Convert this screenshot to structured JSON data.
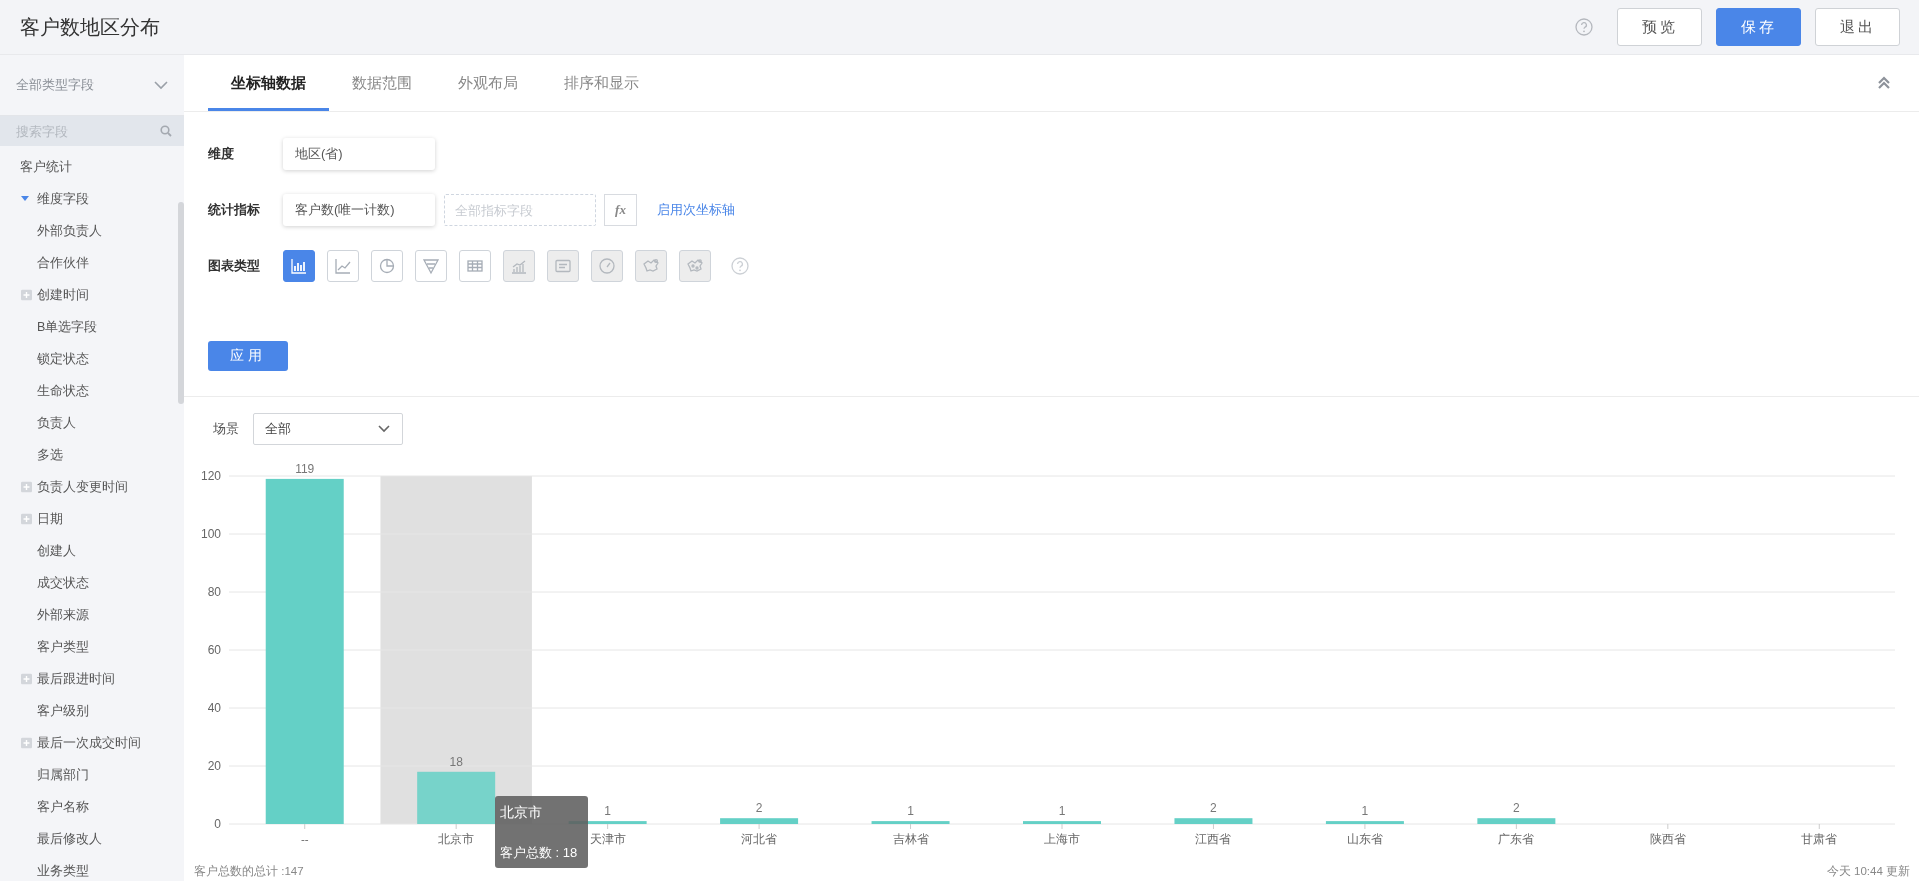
{
  "header": {
    "title": "客户数地区分布",
    "buttons": [
      {
        "label": "预览",
        "kind": "default"
      },
      {
        "label": "保存",
        "kind": "primary"
      },
      {
        "label": "退出",
        "kind": "default"
      }
    ]
  },
  "sidebar": {
    "type_filter": "全部类型字段",
    "search": {
      "placeholder": "搜索字段"
    },
    "tree": [
      {
        "label": "客户统计",
        "children": [
          {
            "label": "维度字段",
            "expanded": true,
            "children": [
              {
                "label": "外部负责人"
              },
              {
                "label": "合作伙伴"
              },
              {
                "label": "创建时间",
                "expanded": false
              },
              {
                "label": "B单选字段"
              },
              {
                "label": "锁定状态"
              },
              {
                "label": "生命状态"
              },
              {
                "label": "负责人"
              },
              {
                "label": "多选"
              },
              {
                "label": "负责人变更时间",
                "expanded": false
              },
              {
                "label": "日期",
                "expanded": false
              },
              {
                "label": "创建人"
              },
              {
                "label": "成交状态"
              },
              {
                "label": "外部来源"
              },
              {
                "label": "客户类型"
              },
              {
                "label": "最后跟进时间",
                "expanded": false
              },
              {
                "label": "客户级别"
              },
              {
                "label": "最后一次成交时间",
                "expanded": false
              },
              {
                "label": "归属部门"
              },
              {
                "label": "客户名称"
              },
              {
                "label": "最后修改人"
              },
              {
                "label": "业务类型"
              }
            ]
          }
        ]
      }
    ]
  },
  "tabs": [
    {
      "label": "坐标轴数据",
      "selected": true
    },
    {
      "label": "数据范围",
      "selected": false
    },
    {
      "label": "外观布局",
      "selected": false
    },
    {
      "label": "排序和显示",
      "selected": false
    }
  ],
  "form": {
    "dimension": {
      "label": "维度",
      "value": "地区(省)"
    },
    "metric": {
      "label": "统计指标",
      "value": "客户数(唯一计数)",
      "secondary": {
        "placeholder": "全部指标字段"
      },
      "fx": "fx",
      "link": "启用次坐标轴"
    },
    "chart_types": {
      "label": "图表类型",
      "items": [
        {
          "kind": "bar",
          "selected": true,
          "disabled": false
        },
        {
          "kind": "line",
          "selected": false,
          "disabled": false
        },
        {
          "kind": "pie",
          "selected": false,
          "disabled": false
        },
        {
          "kind": "funnel",
          "selected": false,
          "disabled": false
        },
        {
          "kind": "table",
          "selected": false,
          "disabled": false
        },
        {
          "kind": "area",
          "selected": false,
          "disabled": true
        },
        {
          "kind": "card",
          "selected": false,
          "disabled": true
        },
        {
          "kind": "gauge",
          "selected": false,
          "disabled": true
        },
        {
          "kind": "map",
          "selected": false,
          "disabled": true
        },
        {
          "kind": "mapdots",
          "selected": false,
          "disabled": true
        }
      ]
    },
    "apply": "应用"
  },
  "scene": {
    "label": "场景",
    "value": "全部"
  },
  "chart": {
    "chart_data": {
      "type": "bar",
      "categories": [
        "--",
        "北京市",
        "天津市",
        "河北省",
        "吉林省",
        "上海市",
        "江西省",
        "山东省",
        "广东省",
        "陕西省",
        "甘肃省"
      ],
      "series": [
        {
          "name": "客户总数",
          "color": "#64d0c6",
          "values": [
            119,
            18,
            1,
            2,
            1,
            1,
            2,
            1,
            2,
            null,
            null
          ]
        }
      ],
      "ylim": [
        0,
        120
      ],
      "yticks": [
        0,
        20,
        40,
        60,
        80,
        100,
        120
      ],
      "grid": true,
      "data_labels": true,
      "bands": [
        {
          "axis": "x",
          "from": "北京市",
          "to": "北京市",
          "color": "#e0e0e0"
        }
      ]
    },
    "tooltip": {
      "title": "北京市",
      "value": ": 18"
    },
    "total": "客户总数的总计 :147",
    "updated": "今天 10:44 更新"
  }
}
